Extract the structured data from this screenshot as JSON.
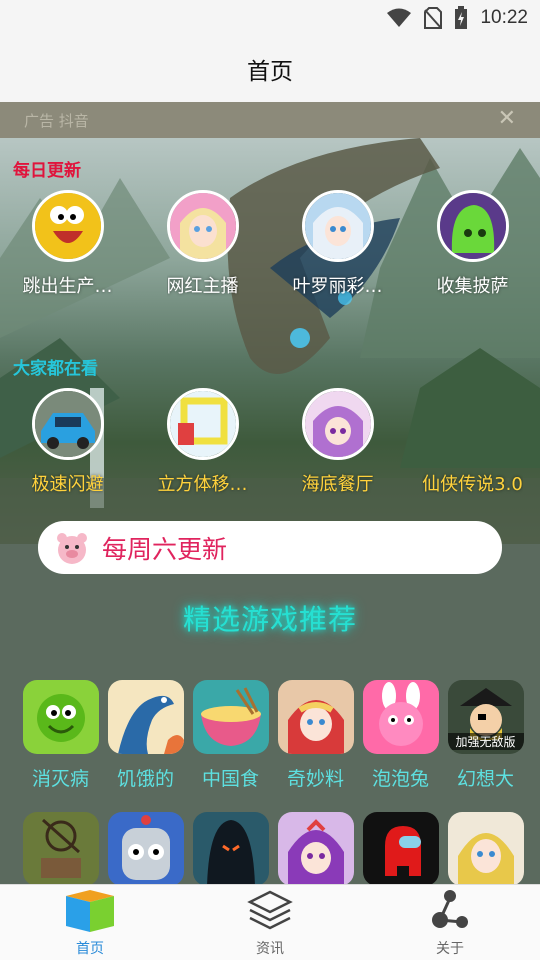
{
  "status": {
    "time": "10:22",
    "icons": [
      "wifi-icon",
      "no-sim-icon",
      "battery-charging-icon"
    ]
  },
  "appbar": {
    "title": "首页"
  },
  "strip": {
    "text": "广告 抖音",
    "close": "✕"
  },
  "banner": {
    "daily_label": "每日更新",
    "popular_label": "大家都在看",
    "daily_games": [
      {
        "name": "跳出生产…",
        "icon": "cartoon-face-icon",
        "color": "#f2c21a"
      },
      {
        "name": "网红主播",
        "icon": "anime-girl-icon",
        "color": "#f2a0c8"
      },
      {
        "name": "叶罗丽彩…",
        "icon": "doll-icon",
        "color": "#b8d8f0"
      },
      {
        "name": "收集披萨",
        "icon": "green-blob-icon",
        "color": "#5a3a8a"
      }
    ],
    "popular_games": [
      {
        "name": "极速闪避",
        "icon": "race-car-icon",
        "color": "#2aa0e0"
      },
      {
        "name": "立方体移…",
        "icon": "cube-icon",
        "color": "#f0f060"
      },
      {
        "name": "海底餐厅",
        "icon": "purple-hair-girl-icon",
        "color": "#c07ad8"
      },
      {
        "name": "仙侠传说3.0",
        "icon": "",
        "color": ""
      }
    ]
  },
  "weekly": {
    "text": "每周六更新",
    "icon": "pig-icon"
  },
  "featured": {
    "title": "精选游戏推荐",
    "row1": [
      {
        "name": "消灭病",
        "icon": "virus-icon",
        "bg": "#8ad23a",
        "fg": "#4a9a10"
      },
      {
        "name": "饥饿的",
        "icon": "snake-icon",
        "bg": "#f5e6c0",
        "fg": "#2a6aa8"
      },
      {
        "name": "中国食",
        "icon": "noodle-bowl-icon",
        "bg": "#3aa8a8",
        "fg": "#e85a8a"
      },
      {
        "name": "奇妙料",
        "icon": "chef-girl-icon",
        "bg": "#e8c8a8",
        "fg": "#d83a3a"
      },
      {
        "name": "泡泡兔",
        "icon": "pink-rabbit-icon",
        "bg": "#ff6aa8",
        "fg": "#ffffff"
      },
      {
        "name": "幻想大",
        "icon": "pirate-icon",
        "bg": "#3a4a3a",
        "fg": "#e8c83a",
        "badge": "加强无敌版"
      }
    ],
    "row2": [
      {
        "name": "",
        "icon": "crossbow-icon",
        "bg": "#6a7a3a",
        "fg": "#3a2a1a"
      },
      {
        "name": "",
        "icon": "robot-icon",
        "bg": "#3a6ac8",
        "fg": "#c8d0d8"
      },
      {
        "name": "",
        "icon": "hooded-figure-icon",
        "bg": "#2a5a6a",
        "fg": "#101820"
      },
      {
        "name": "",
        "icon": "witch-girl-icon",
        "bg": "#d8b8e8",
        "fg": "#8a3ab8"
      },
      {
        "name": "",
        "icon": "red-crewmate-icon",
        "bg": "#111111",
        "fg": "#e01a1a"
      },
      {
        "name": "",
        "icon": "blonde-doll-icon",
        "bg": "#f0e8d8",
        "fg": "#e8c84a"
      }
    ]
  },
  "nav": [
    {
      "label": "首页",
      "icon": "home-cube-icon",
      "active": true
    },
    {
      "label": "资讯",
      "icon": "layers-icon",
      "active": false
    },
    {
      "label": "关于",
      "icon": "share-nodes-icon",
      "active": false
    }
  ],
  "colors": {
    "accent": "#2a8bd8",
    "daily": "#e0143c",
    "popular": "#26c6da",
    "weekly": "#e0245e",
    "featured": "#26e0d2"
  }
}
